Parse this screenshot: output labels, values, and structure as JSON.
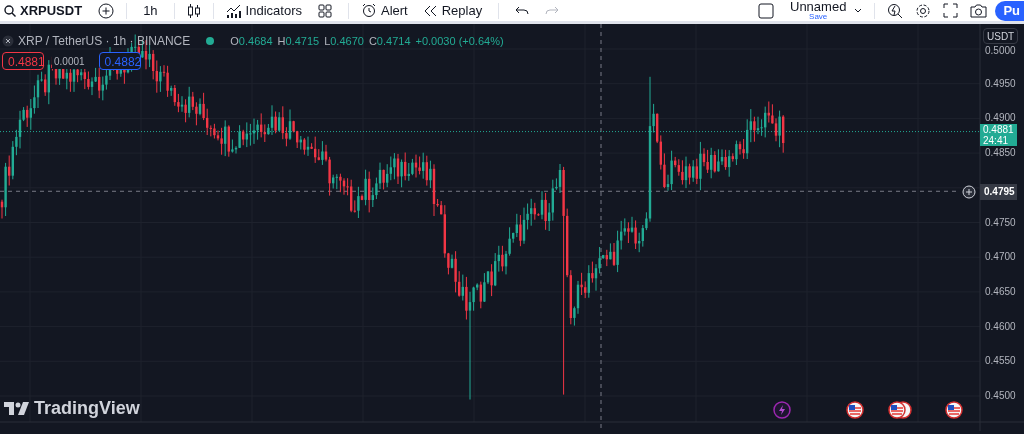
{
  "toolbar": {
    "symbol": "XRPUSDT",
    "interval": "1h",
    "indicators": "Indicators",
    "alert": "Alert",
    "replay": "Replay",
    "layout_name": "Unnamed",
    "save": "Save",
    "publish": "Pu"
  },
  "legend": {
    "title": "XRP / TetherUS · 1h · BINANCE",
    "ohlc": [
      {
        "label": "O",
        "value": "0.4684"
      },
      {
        "label": "H",
        "value": "0.4715"
      },
      {
        "label": "L",
        "value": "0.4670"
      },
      {
        "label": "C",
        "value": "0.4714"
      }
    ],
    "change": "+0.0030 (+0.64%)"
  },
  "trade": {
    "sell": "0.4881",
    "spread": "0.0001",
    "buy": "0.4882"
  },
  "price_axis": {
    "currency": "USDT",
    "ticks": [
      "0.5000",
      "0.4950",
      "0.4900",
      "0.4850",
      "0.4750",
      "0.4700",
      "0.4650",
      "0.4600",
      "0.4550",
      "0.4500"
    ],
    "last_price": "0.4881",
    "countdown": "24:41",
    "crosshair_price": "0.4795"
  },
  "brand": "TradingView"
}
